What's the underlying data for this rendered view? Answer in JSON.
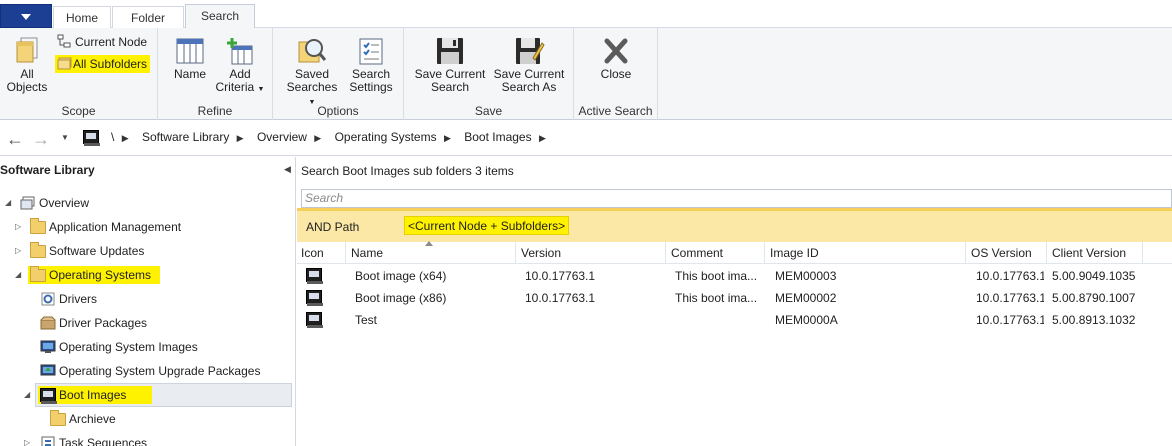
{
  "tabs": [
    {
      "label": "Home"
    },
    {
      "label": "Folder"
    },
    {
      "label": "Search"
    }
  ],
  "ribbon": {
    "scope": {
      "all_objects_line1": "All",
      "all_objects_line2": "Objects",
      "current_node": "Current Node",
      "all_subfolders": "All Subfolders",
      "label": "Scope"
    },
    "refine": {
      "name": "Name",
      "add_criteria_line1": "Add",
      "add_criteria_line2": "Criteria",
      "label": "Refine"
    },
    "options": {
      "saved_searches_line1": "Saved",
      "saved_searches_line2": "Searches",
      "search_settings_line1": "Search",
      "search_settings_line2": "Settings",
      "label": "Options"
    },
    "save": {
      "save_current_search_line1": "Save Current",
      "save_current_search_line2": "Search",
      "save_current_search_as_line1": "Save Current",
      "save_current_search_as_line2": "Search As",
      "label": "Save"
    },
    "active_search": {
      "close": "Close",
      "label": "Active Search"
    }
  },
  "address": {
    "root": "\\",
    "crumbs": [
      "Software Library",
      "Overview",
      "Operating Systems",
      "Boot Images"
    ]
  },
  "left_pane": {
    "title": "Software Library",
    "tree": {
      "overview": "Overview",
      "application_management": "Application Management",
      "software_updates": "Software Updates",
      "operating_systems": "Operating Systems",
      "drivers": "Drivers",
      "driver_packages": "Driver Packages",
      "os_images": "Operating System Images",
      "os_upgrade_packages": "Operating System Upgrade Packages",
      "boot_images": "Boot Images",
      "archieve": "Archieve",
      "task_sequences": "Task Sequences"
    }
  },
  "right_pane": {
    "title_bold": "Search Boot Images sub folders",
    "title_count": "3 items",
    "search_placeholder": "Search",
    "criteria_label": "AND Path",
    "criteria_value": "<Current Node + Subfolders>",
    "columns": {
      "icon": "Icon",
      "name": "Name",
      "version": "Version",
      "comment": "Comment",
      "image_id": "Image ID",
      "os_version": "OS Version",
      "client_version": "Client Version"
    },
    "rows": [
      {
        "name": "Boot image (x64)",
        "version": "10.0.17763.1",
        "comment": "This boot ima...",
        "image_id": "MEM00003",
        "os_version": "10.0.17763.1",
        "client_version": "5.00.9049.1035"
      },
      {
        "name": "Boot image (x86)",
        "version": "10.0.17763.1",
        "comment": "This boot ima...",
        "image_id": "MEM00002",
        "os_version": "10.0.17763.1",
        "client_version": "5.00.8790.1007"
      },
      {
        "name": "Test",
        "version": "",
        "comment": "",
        "image_id": "MEM0000A",
        "os_version": "10.0.17763.1",
        "client_version": "5.00.8913.1032"
      }
    ]
  }
}
